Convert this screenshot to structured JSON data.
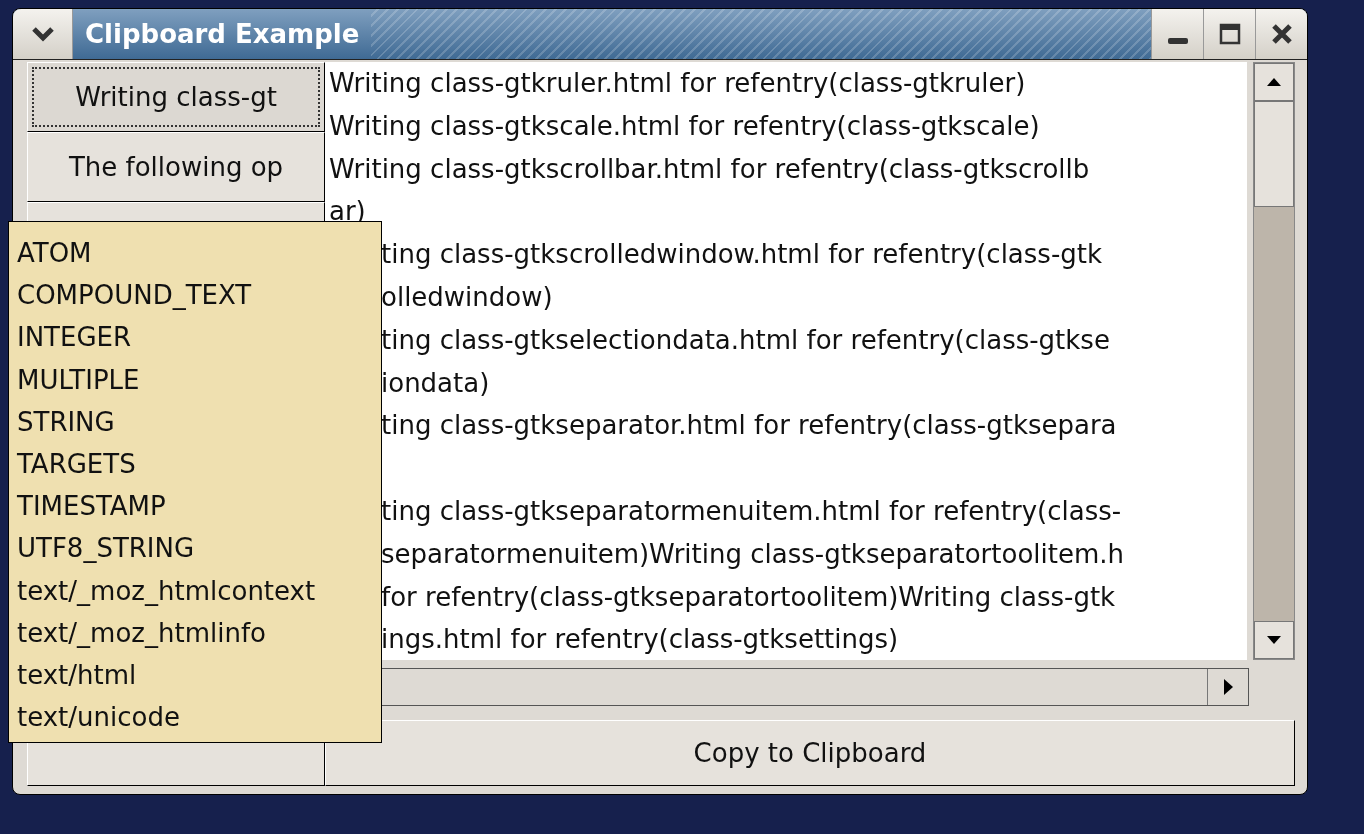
{
  "window": {
    "title": "Clipboard Example"
  },
  "side_buttons": [
    {
      "label": "Writing class-gt",
      "focused": true
    },
    {
      "label": "The following op",
      "focused": false
    }
  ],
  "text_lines": [
    {
      "kind": "full",
      "text": "Writing class-gtkruler.html for refentry(class-gtkruler)"
    },
    {
      "kind": "full",
      "text": "Writing class-gtkscale.html for refentry(class-gtkscale)"
    },
    {
      "kind": "full",
      "text": "Writing class-gtkscrollbar.html for refentry(class-gtkscrollb"
    },
    {
      "kind": "full",
      "text": "ar)"
    },
    {
      "kind": "partial",
      "text": "ting class-gtkscrolledwindow.html for refentry(class-gtk"
    },
    {
      "kind": "partial",
      "text": "olledwindow)"
    },
    {
      "kind": "partial",
      "text": "ting class-gtkselectiondata.html for refentry(class-gtkse"
    },
    {
      "kind": "partial",
      "text": "iondata)"
    },
    {
      "kind": "partial",
      "text": "ting class-gtkseparator.html for refentry(class-gtksepara"
    },
    {
      "kind": "blank"
    },
    {
      "kind": "partial",
      "text": "ting class-gtkseparatormenuitem.html for refentry(class-"
    },
    {
      "kind": "partial",
      "text": "separatormenuitem)Writing class-gtkseparatortoolitem.h"
    },
    {
      "kind": "partial",
      "text": "for refentry(class-gtkseparatortoolitem)Writing class-gtk"
    },
    {
      "kind": "partial",
      "text": "ings.html for refentry(class-gtksettings)"
    }
  ],
  "copy_button": {
    "label": "Copy to Clipboard"
  },
  "popup_menu": {
    "items": [
      "ATOM",
      "COMPOUND_TEXT",
      "INTEGER",
      "MULTIPLE",
      "STRING",
      "TARGETS",
      "TIMESTAMP",
      "UTF8_STRING",
      "text/_moz_htmlcontext",
      "text/_moz_htmlinfo",
      "text/html",
      "text/unicode"
    ]
  }
}
